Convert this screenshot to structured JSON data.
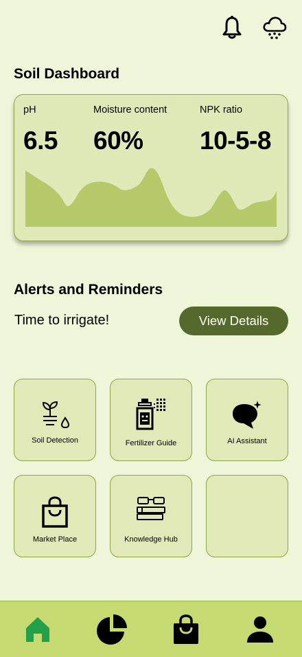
{
  "header": {
    "notification_icon": "bell-icon",
    "weather_icon": "cloud-rain-icon"
  },
  "soil_dashboard": {
    "title": "Soil Dashboard",
    "metrics": [
      {
        "label": "pH",
        "value": "6.5"
      },
      {
        "label": "Moisture content",
        "value": "60%"
      },
      {
        "label": "NPK ratio",
        "value": "10-5-8"
      }
    ]
  },
  "alerts": {
    "title": "Alerts and Reminders",
    "message": "Time to irrigate!",
    "button_label": "View Details"
  },
  "tiles": [
    {
      "label": "Soil Detection",
      "icon": "seedling-drop-icon"
    },
    {
      "label": "Fertilizer Guide",
      "icon": "fertilizer-bottle-icon"
    },
    {
      "label": "AI Assistant",
      "icon": "ai-chat-sparkle-icon"
    },
    {
      "label": "Market Place",
      "icon": "shopping-bag-icon"
    },
    {
      "label": "Knowledge Hub",
      "icon": "glasses-books-icon"
    },
    {
      "label": "",
      "icon": ""
    }
  ],
  "bottom_nav": [
    {
      "name": "home",
      "icon": "home-icon",
      "active": true
    },
    {
      "name": "analytics",
      "icon": "pie-chart-icon",
      "active": false
    },
    {
      "name": "shop",
      "icon": "shopping-bag-icon",
      "active": false
    },
    {
      "name": "profile",
      "icon": "person-icon",
      "active": false
    }
  ],
  "colors": {
    "background": "#eef5d9",
    "card": "#dfe9b7",
    "card_border": "#8aa645",
    "chart_fill": "#b5c96a",
    "button": "#55692c",
    "nav_bar": "#c5db72",
    "nav_active": "#22a04a"
  }
}
